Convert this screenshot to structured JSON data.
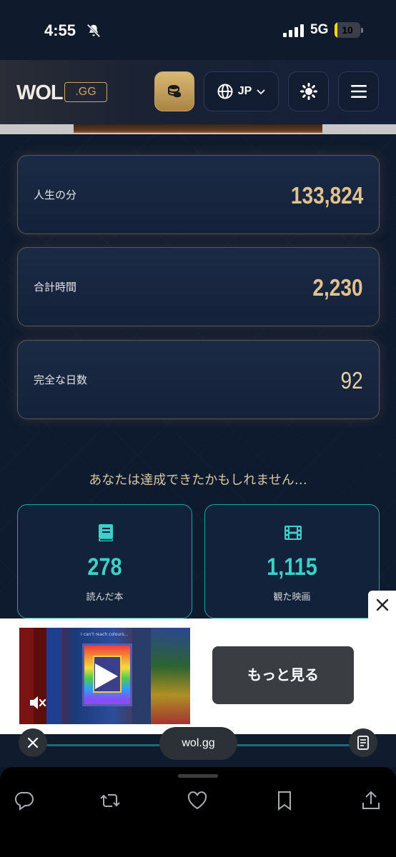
{
  "status_bar": {
    "time": "4:55",
    "network": "5G",
    "battery": "10",
    "battery_level": 0.1
  },
  "header": {
    "logo": "WOL",
    "logo_badge": ".GG",
    "language": "JP"
  },
  "stats": [
    {
      "label": "人生の分",
      "value": "133,824"
    },
    {
      "label": "合計時間",
      "value": "2,230"
    },
    {
      "label": "完全な日数",
      "value": "92"
    }
  ],
  "achievements": {
    "heading": "あなたは達成できたかもしれません…",
    "items": [
      {
        "icon": "book-icon",
        "value": "278",
        "label": "読んだ本"
      },
      {
        "icon": "film-icon",
        "value": "1,115",
        "label": "観た映画"
      }
    ]
  },
  "ad": {
    "cta": "もっと見る",
    "video_caption": "I can't reach colours..."
  },
  "browser": {
    "url": "wol.gg"
  },
  "colors": {
    "gold": "#e2c28c",
    "teal": "#3ed0c8",
    "background": "#0e1a2e"
  }
}
